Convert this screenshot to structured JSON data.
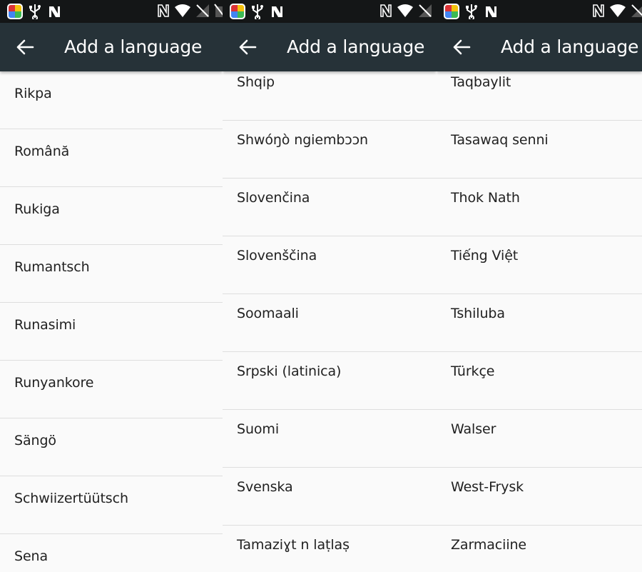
{
  "colors": {
    "status_bar": "#141617",
    "app_bar": "#263238",
    "list_background": "#fafafa",
    "divider": "#dedede",
    "title_text": "#ffffff",
    "item_text": "#212121"
  },
  "status_bar": {
    "left_icons": [
      "app-launcher-icon",
      "usb-icon",
      "nfc-n-icon"
    ],
    "right_icons": [
      "nfc-icon",
      "wifi-icon",
      "signal-off-icon",
      "battery-icon"
    ]
  },
  "panels": [
    {
      "title": "Add a language",
      "items": [
        "Rikpa",
        "Română",
        "Rukiga",
        "Rumantsch",
        "Runasimi",
        "Runyankore",
        "Sängö",
        "Schwiizertüütsch",
        "Sena"
      ]
    },
    {
      "title": "Add a language",
      "items": [
        "Shqip",
        "Shwóŋò ngiembɔɔn",
        "Slovenčina",
        "Slovenščina",
        "Soomaali",
        "Srpski (latinica)",
        "Suomi",
        "Svenska",
        "Tamaziɣt n laṭlaṣ"
      ]
    },
    {
      "title": "Add a language",
      "items": [
        "Taqbaylit",
        "Tasawaq senni",
        "Thok Nath",
        "Tiếng Việt",
        "Tshiluba",
        "Türkçe",
        "Walser",
        "West-Frysk",
        "Zarmaciine"
      ]
    }
  ]
}
